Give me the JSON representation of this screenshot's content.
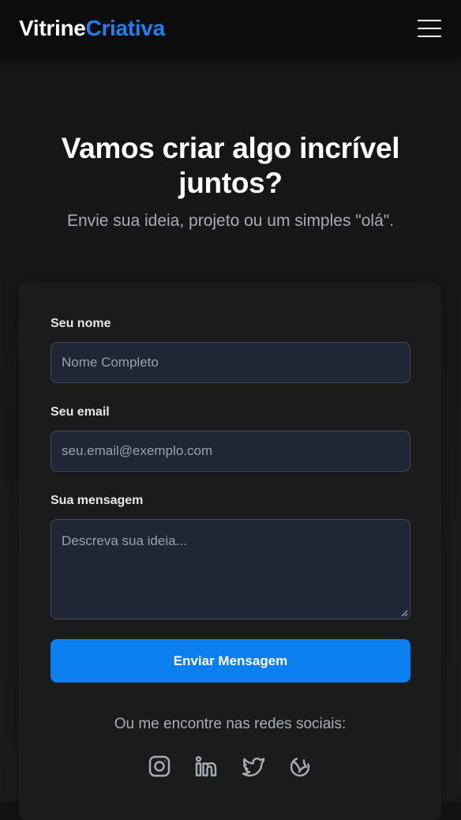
{
  "header": {
    "logo_primary": "Vitrine",
    "logo_accent": "Criativa",
    "menu_icon": "hamburger-menu-icon"
  },
  "hero": {
    "title": "Vamos criar algo incrível juntos?",
    "subtitle": "Envie sua ideia, projeto ou um simples \"olá\"."
  },
  "form": {
    "name_label": "Seu nome",
    "name_placeholder": "Nome Completo",
    "email_label": "Seu email",
    "email_placeholder": "seu.email@exemplo.com",
    "message_label": "Sua mensagem",
    "message_placeholder": "Descreva sua ideia...",
    "submit_label": "Enviar Mensagem"
  },
  "social": {
    "caption": "Ou me encontre nas redes sociais:",
    "icons": [
      "instagram-icon",
      "linkedin-icon",
      "twitter-icon",
      "dribbble-icon"
    ]
  },
  "colors": {
    "accent": "#1d7ff0",
    "button": "#0b7ef0",
    "background": "#131313",
    "card": "#1b1b1b",
    "input_bg": "#1f2736",
    "input_border": "#404a5c",
    "muted_text": "#a7adb7"
  }
}
